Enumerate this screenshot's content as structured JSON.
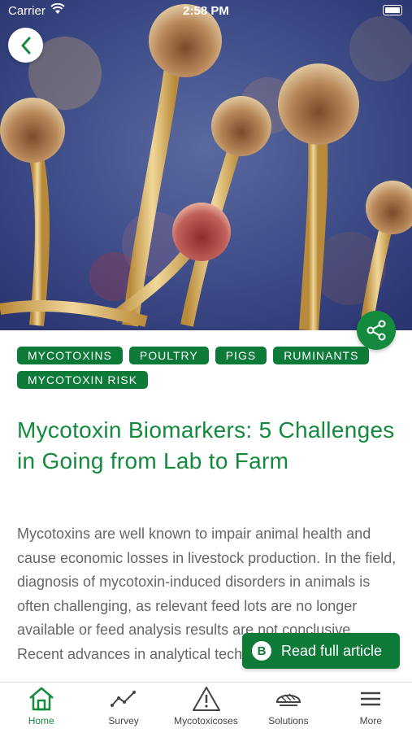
{
  "status_bar": {
    "carrier": "Carrier",
    "time": "2:58 PM"
  },
  "article": {
    "tags": [
      "MYCOTOXINS",
      "POULTRY",
      "PIGS",
      "RUMINANTS",
      "MYCOTOXIN RISK"
    ],
    "title": "Mycotoxin Biomarkers: 5 Challenges in Going from Lab to Farm",
    "body": "Mycotoxins are well known to impair animal health and cause economic losses in livestock production. In the field, diagnosis of mycotoxin-induced disorders in animals is often challenging, as relevant feed lots are no longer available or feed analysis results are not conclusive. Recent advances in analytical techniques, the application",
    "read_button_label": "Read full article"
  },
  "tabbar": {
    "items": [
      {
        "label": "Home",
        "icon": "home-icon",
        "active": true
      },
      {
        "label": "Survey",
        "icon": "trend-line-icon"
      },
      {
        "label": "Mycotoxicoses",
        "icon": "warning-icon"
      },
      {
        "label": "Solutions",
        "icon": "solutions-icon"
      },
      {
        "label": "More",
        "icon": "menu-icon"
      }
    ]
  },
  "colors": {
    "accent": "#138a3d",
    "tag_bg": "#0e7a38",
    "body_text": "#666666"
  }
}
